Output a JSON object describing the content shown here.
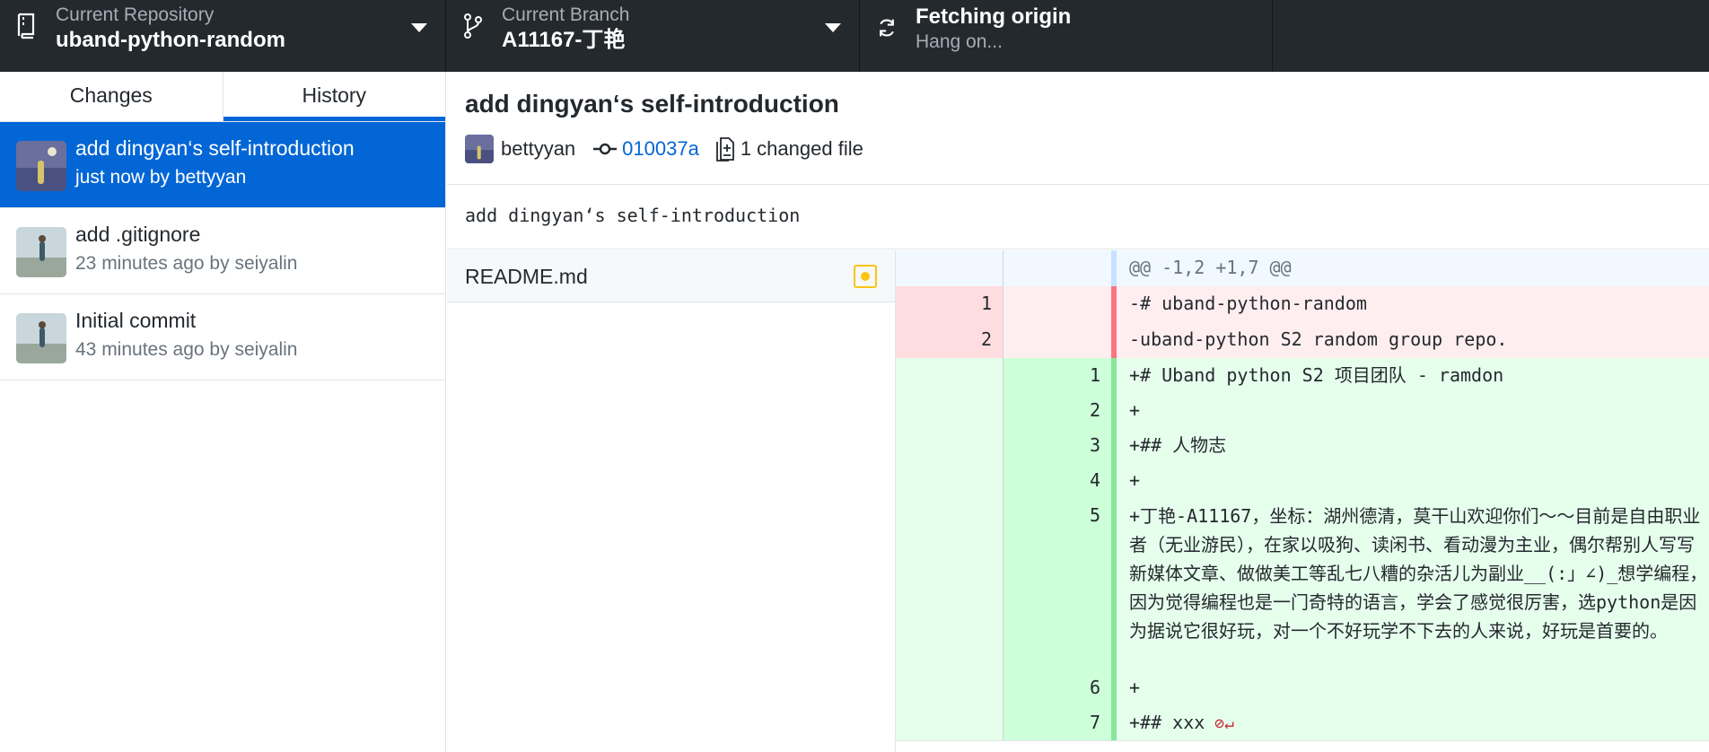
{
  "toolbar": {
    "repository": {
      "description": "Current Repository",
      "title": "uband-python-random"
    },
    "branch": {
      "description": "Current Branch",
      "title": "A11167-丁艳"
    },
    "fetch": {
      "title": "Fetching origin",
      "description": "Hang on..."
    }
  },
  "sidebar": {
    "tabs": [
      {
        "label": "Changes"
      },
      {
        "label": "History"
      }
    ],
    "commits": [
      {
        "title": "add dingyan‘s self-introduction",
        "meta": "just now by bettyyan"
      },
      {
        "title": "add .gitignore",
        "meta": "23 minutes ago by seiyalin"
      },
      {
        "title": "Initial commit",
        "meta": "43 minutes ago by seiyalin"
      }
    ]
  },
  "commit": {
    "summary": "add dingyan‘s self-introduction",
    "author": "bettyyan",
    "sha": "010037a",
    "files_changed": "1 changed file",
    "body": "add dingyan‘s self-introduction"
  },
  "files": [
    {
      "name": "README.md",
      "status": "modified"
    }
  ],
  "diff": {
    "hunk": "@@ -1,2 +1,7 @@",
    "deleted": [
      {
        "old": "1",
        "text": "-# uband-python-random"
      },
      {
        "old": "2",
        "text": "-uband-python S2 random group repo."
      }
    ],
    "added": [
      {
        "new": "1",
        "text": "+# Uband python S2 项目团队 - ramdon"
      },
      {
        "new": "2",
        "text": "+"
      },
      {
        "new": "3",
        "text": "+## 人物志"
      },
      {
        "new": "4",
        "text": "+"
      },
      {
        "new": "5",
        "text": "+丁艳-A11167，坐标：湖州德清，莫干山欢迎你们～～目前是自由职业者（无业游民），在家以吸狗、读闲书、看动漫为主业，偶尔帮别人写写新媒体文章、做做美工等乱七八糟的杂活儿为副业__(:」∠)_想学编程，因为觉得编程也是一门奇特的语言，学会了感觉很厉害，选python是因为据说它很好玩，对一个不好玩学不下去的人来说，好玩是首要的。"
      },
      {
        "new": "6",
        "text": "+"
      },
      {
        "new": "7",
        "text": "+## xxx"
      }
    ]
  },
  "colors": {
    "toolbar_bg": "#24292e",
    "accent": "#0366d6",
    "added_bg": "#e6ffed",
    "deleted_bg": "#ffeef0",
    "modified_badge": "#f9c513"
  }
}
